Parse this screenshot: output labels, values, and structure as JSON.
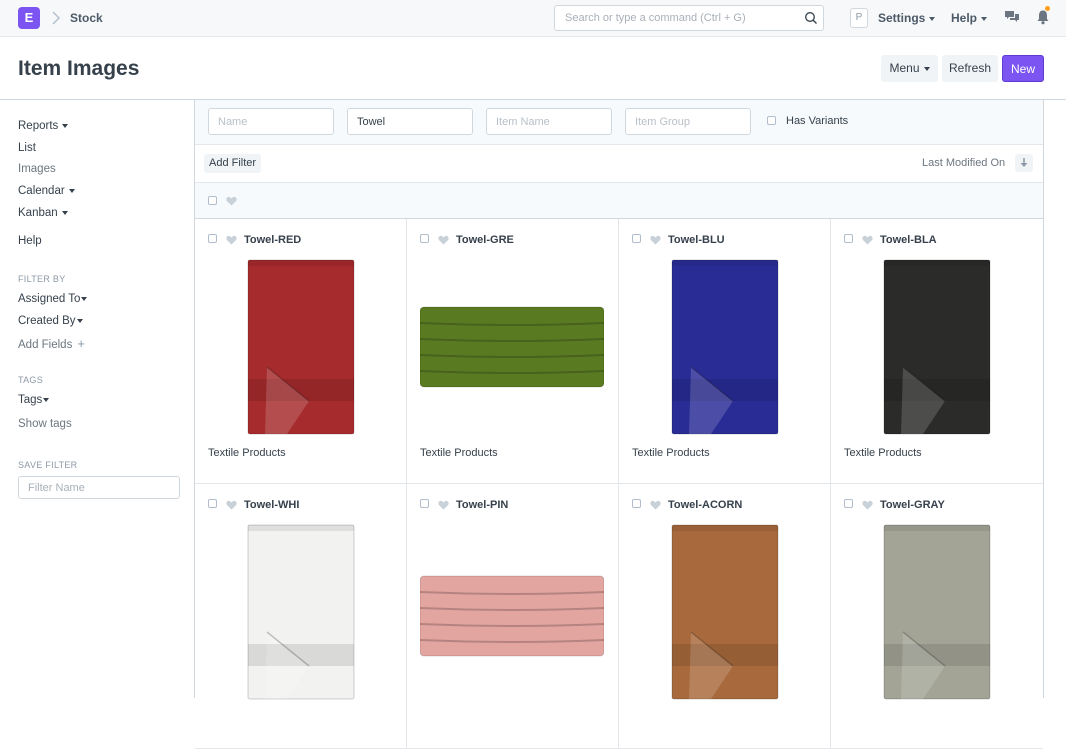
{
  "navbar": {
    "logo_letter": "E",
    "breadcrumb": "Stock",
    "search_placeholder": "Search or type a command (Ctrl + G)",
    "avatar_letter": "P",
    "settings_label": "Settings",
    "help_label": "Help"
  },
  "page": {
    "title": "Item Images",
    "menu_label": "Menu",
    "refresh_label": "Refresh",
    "new_label": "New"
  },
  "sidebar": {
    "reports": "Reports",
    "list": "List",
    "images": "Images",
    "calendar": "Calendar",
    "kanban": "Kanban",
    "help": "Help",
    "filter_by_heading": "FILTER BY",
    "assigned_to": "Assigned To",
    "created_by": "Created By",
    "add_fields": "Add Fields",
    "tags_heading": "TAGS",
    "tags": "Tags",
    "show_tags": "Show tags",
    "save_filter_heading": "SAVE FILTER",
    "filter_name_placeholder": "Filter Name"
  },
  "filters": {
    "name_placeholder": "Name",
    "item_code_value": "Towel",
    "item_name_placeholder": "Item Name",
    "item_group_placeholder": "Item Group",
    "has_variants_label": "Has Variants",
    "add_filter_label": "Add Filter",
    "sort_label": "Last Modified On"
  },
  "cards": [
    {
      "title": "Towel-RED",
      "group": "Textile Products",
      "color": "#a62b2d",
      "shape": "hanging"
    },
    {
      "title": "Towel-GRE",
      "group": "Textile Products",
      "color": "#5a7a22",
      "shape": "folded"
    },
    {
      "title": "Towel-BLU",
      "group": "Textile Products",
      "color": "#2a2c96",
      "shape": "hanging"
    },
    {
      "title": "Towel-BLA",
      "group": "Textile Products",
      "color": "#2b2b29",
      "shape": "hanging"
    },
    {
      "title": "Towel-WHI",
      "group": "",
      "color": "#f2f2f0",
      "shape": "hanging"
    },
    {
      "title": "Towel-PIN",
      "group": "",
      "color": "#e3a5a0",
      "shape": "folded"
    },
    {
      "title": "Towel-ACORN",
      "group": "",
      "color": "#a8693c",
      "shape": "hanging"
    },
    {
      "title": "Towel-GRAY",
      "group": "",
      "color": "#a3a496",
      "shape": "hanging"
    }
  ]
}
